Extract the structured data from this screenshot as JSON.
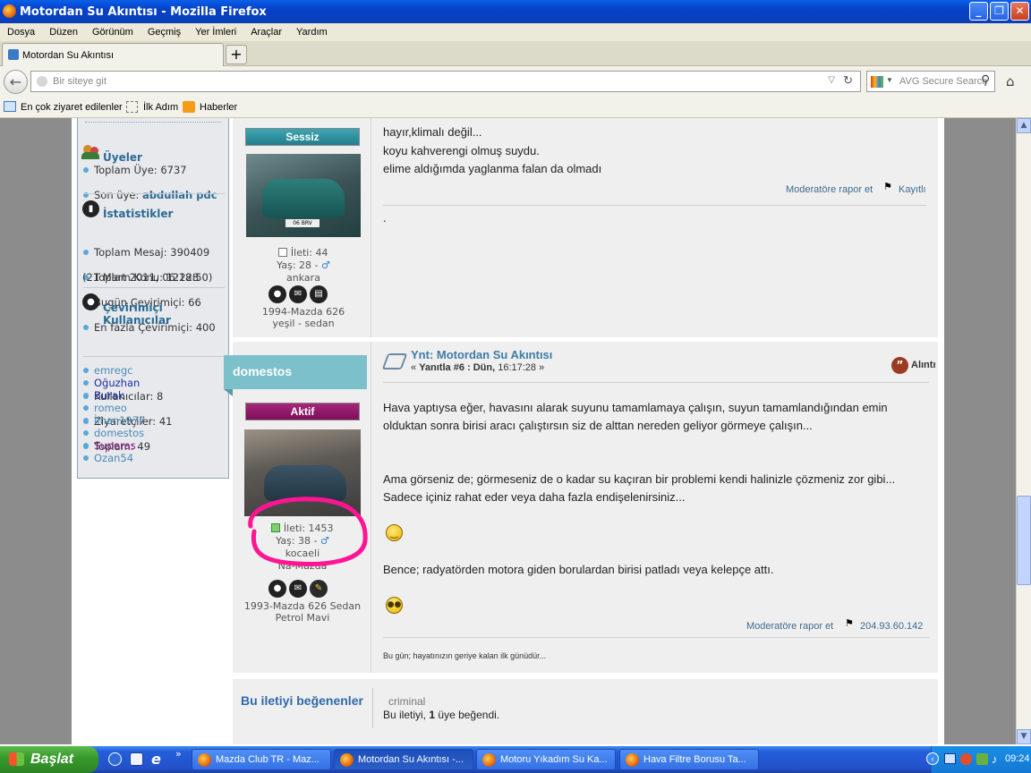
{
  "window": {
    "title": "Motordan Su Akıntısı - Mozilla Firefox",
    "buttons": {
      "min": "_",
      "max": "❐",
      "close": "✕"
    }
  },
  "menu": [
    "Dosya",
    "Düzen",
    "Görünüm",
    "Geçmiş",
    "Yer İmleri",
    "Araçlar",
    "Yardım"
  ],
  "tab": {
    "title": "Motordan Su Akıntısı",
    "new_tab": "+"
  },
  "nav": {
    "url_placeholder": "Bir siteye git",
    "search_placeholder": "AVG Secure Search"
  },
  "bookmarks": [
    "En çok ziyaret edilenler",
    "İlk Adım",
    "Haberler"
  ],
  "sidebar": {
    "members_title": "Üyeler",
    "members": {
      "total": "Toplam Üye: 6737",
      "last_label": "Son üye:",
      "last_user": "abdullah pdc"
    },
    "stats_title": "İstatistikler",
    "stats": [
      "Toplam Mesaj: 390409",
      "Toplam Konu: 12228",
      "Bugün Çevirimiçi: 66",
      "En fazla Çevirimiçi: 400"
    ],
    "stats_date": "(21 Mart 2011, 06:18:50)",
    "online_title": "Çevirimiçi Kullanıcılar",
    "online": [
      "Kullanıcılar: 8",
      "Ziyaretçiler: 41",
      "Toplam: 49"
    ],
    "users": [
      {
        "name": "emregc",
        "color": "#4a8ab8"
      },
      {
        "name": "Oğuzhan",
        "color": "#1b2fa0"
      },
      {
        "name": "Burak",
        "color": "#1b2fa0"
      },
      {
        "name": "romeo",
        "color": "#4a8ab8"
      },
      {
        "name": "İlhan1977",
        "color": "#4a8ab8"
      },
      {
        "name": "domestos",
        "color": "#4a8ab8"
      },
      {
        "name": "Superas",
        "color": "#8b1a8b"
      },
      {
        "name": "Ozan54",
        "color": "#4a8ab8"
      }
    ]
  },
  "post1": {
    "status": "Sessiz",
    "info": {
      "posts": "İleti: 44",
      "age": "Yaş: 28 -",
      "city": "ankara",
      "car": "1994-Mazda 626",
      "car2": "yeşil - sedan"
    },
    "plate": "06 BRV",
    "lines": [
      "hayır,klimalı değil...",
      "koyu kahverengi olmuş suydu.",
      "elime aldığımda yaglanma falan da olmadı"
    ],
    "report": "Moderatöre rapor et",
    "registered": "Kayıtlı",
    "signature": "."
  },
  "post2": {
    "username": "domestos",
    "status": "Aktif",
    "info": {
      "posts": "İleti: 1453",
      "age": "Yaş: 38 -",
      "city": "kocaeli",
      "club": "Na-Mazda",
      "car": "1993-Mazda 626 Sedan",
      "car2": "Petrol Mavi"
    },
    "title": "Ynt: Motordan Su Akıntısı",
    "meta_prefix": "«",
    "meta_reply": "Yanıtla #6 : Dün,",
    "meta_time": "16:17:28 »",
    "quote": "Alıntı",
    "paragraphs": [
      "Hava yaptıysa eğer, havasını alarak suyunu tamamlamaya çalışın, suyun tamamlandığından emin olduktan sonra birisi aracı çalıştırsın siz de alttan nereden geliyor görmeye çalışın...",
      "Ama görseniz de; görmeseniz de o kadar su kaçıran bir problemi kendi halinizle çözmeniz zor gibi... Sadece içiniz rahat eder veya daha fazla endişelenirsiniz...",
      "Bence; radyatörden motora giden borulardan birisi patladı veya kelepçe attı."
    ],
    "report": "Moderatöre rapor et",
    "ip": "204.93.60.142",
    "signature": "Bu gün; hayatınızın geriye kalan ilk günüdür..."
  },
  "likes": {
    "title": "Bu iletiyi beğenenler",
    "user": "criminal",
    "text_pre": "Bu iletiyi,",
    "count": "1",
    "text_post": "üye beğendi."
  },
  "taskbar": {
    "start": "Başlat",
    "tasks": [
      "Mazda Club TR - Maz...",
      "Motordan Su Akıntısı -...",
      "Motoru Yıkadım Su Ka...",
      "Hava Filtre Borusu Ta..."
    ],
    "clock": "09:24"
  },
  "colors": {
    "sessiz": "#2b8d9a",
    "aktif": "#8c1566",
    "highlight_circle": "#ff1493",
    "username_box": "#7cc0cc"
  }
}
